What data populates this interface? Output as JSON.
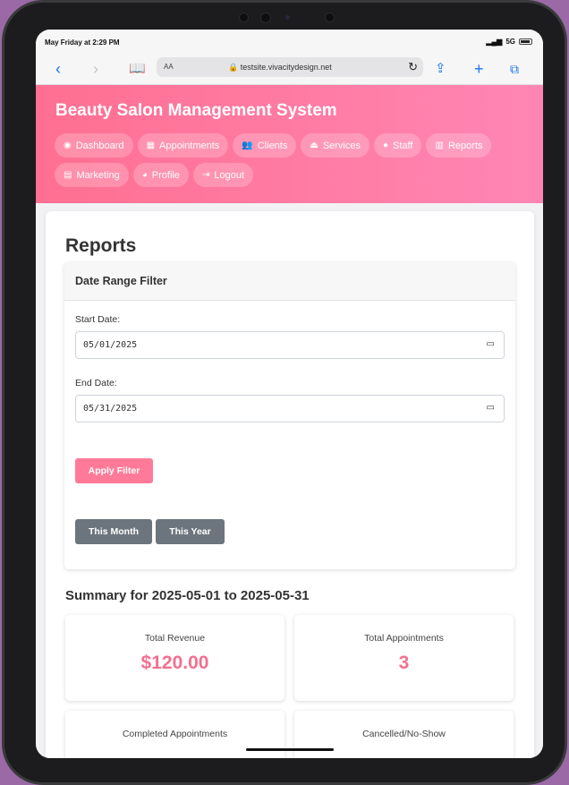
{
  "status_bar": {
    "time": "May Friday at 2:29 PM",
    "signal": "5G"
  },
  "browser": {
    "url": "testsite.vivacitydesign.net",
    "text_size_label": "AA"
  },
  "app": {
    "title": "Beauty Salon Management System",
    "nav": [
      {
        "label": "Dashboard",
        "icon": "gauge-icon",
        "glyph": "◉"
      },
      {
        "label": "Appointments",
        "icon": "calendar-icon",
        "glyph": "▦"
      },
      {
        "label": "Clients",
        "icon": "users-icon",
        "glyph": "👥"
      },
      {
        "label": "Services",
        "icon": "bell-service-icon",
        "glyph": "⏏"
      },
      {
        "label": "Staff",
        "icon": "user-icon",
        "glyph": "●"
      },
      {
        "label": "Reports",
        "icon": "chart-icon",
        "glyph": "▥"
      },
      {
        "label": "Marketing",
        "icon": "chart-line-icon",
        "glyph": "▤"
      },
      {
        "label": "Profile",
        "icon": "user-circle-icon",
        "glyph": "◕"
      },
      {
        "label": "Logout",
        "icon": "sign-out-icon",
        "glyph": "⇥"
      }
    ]
  },
  "reports": {
    "title": "Reports",
    "filter": {
      "heading": "Date Range Filter",
      "start_label": "Start Date:",
      "start_value": "05/01/2025",
      "end_label": "End Date:",
      "end_value": "05/31/2025",
      "apply_label": "Apply Filter",
      "this_month_label": "This Month",
      "this_year_label": "This Year"
    },
    "summary": {
      "title": "Summary for 2025-05-01 to 2025-05-31",
      "stats": [
        {
          "label": "Total Revenue",
          "value": "$120.00"
        },
        {
          "label": "Total Appointments",
          "value": "3"
        },
        {
          "label": "Completed Appointments",
          "value": ""
        },
        {
          "label": "Cancelled/No-Show",
          "value": ""
        }
      ]
    }
  },
  "colors": {
    "accent": "#ff7a98",
    "header_start": "#ff6f91",
    "header_end": "#ff86b4",
    "stat_value": "#f2708f",
    "secondary_button": "#6c757d"
  }
}
